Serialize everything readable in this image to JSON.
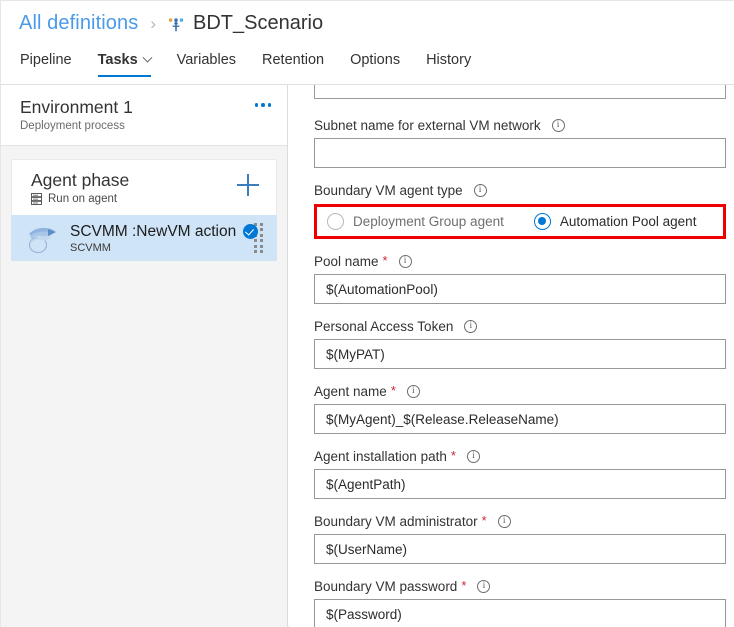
{
  "breadcrumb": {
    "root_label": "All definitions",
    "separator": "›",
    "current_label": "BDT_Scenario",
    "current_icon": "release-definition-icon"
  },
  "tabs": [
    {
      "label": "Pipeline",
      "active": false,
      "has_caret": false
    },
    {
      "label": "Tasks",
      "active": true,
      "has_caret": true
    },
    {
      "label": "Variables",
      "active": false,
      "has_caret": false
    },
    {
      "label": "Retention",
      "active": false,
      "has_caret": false
    },
    {
      "label": "Options",
      "active": false,
      "has_caret": false
    },
    {
      "label": "History",
      "active": false,
      "has_caret": false
    }
  ],
  "left_panel": {
    "environment": {
      "title": "Environment 1",
      "subtitle": "Deployment process",
      "more_icon": "ellipsis-icon"
    },
    "phase": {
      "title": "Agent phase",
      "subtitle": "Run on agent",
      "subtitle_icon": "server-icon",
      "add_icon": "plus-icon"
    },
    "task": {
      "title": "SCVMM :NewVM action",
      "subtitle": "SCVMM",
      "icon": "scvmm-icon",
      "status_icon": "check-circle-icon",
      "grip_icon": "drag-handle-icon",
      "selected": true
    }
  },
  "form": {
    "partial_field_top": {
      "value": "",
      "has_validation_squiggle": true
    },
    "fields": [
      {
        "id": "subnet-name",
        "label": "Subnet name for external VM network",
        "required": false,
        "info_icon": "info-icon",
        "value": "",
        "placeholder": ""
      },
      {
        "id": "pool-name",
        "label": "Pool name",
        "required": true,
        "info_icon": "info-icon",
        "value": "$(AutomationPool)",
        "placeholder": ""
      },
      {
        "id": "personal-access-token",
        "label": "Personal Access Token",
        "required": false,
        "info_icon": "info-icon",
        "value": "$(MyPAT)",
        "placeholder": ""
      },
      {
        "id": "agent-name",
        "label": "Agent name",
        "required": true,
        "info_icon": "info-icon",
        "value": "$(MyAgent)_$(Release.ReleaseName)",
        "placeholder": ""
      },
      {
        "id": "agent-installation-path",
        "label": "Agent installation path",
        "required": true,
        "info_icon": "info-icon",
        "value": "$(AgentPath)",
        "placeholder": ""
      },
      {
        "id": "boundary-vm-administrator",
        "label": "Boundary VM administrator",
        "required": true,
        "info_icon": "info-icon",
        "value": "$(UserName)",
        "placeholder": ""
      },
      {
        "id": "boundary-vm-password",
        "label": "Boundary VM password",
        "required": true,
        "info_icon": "info-icon",
        "value": "$(Password)",
        "placeholder": ""
      }
    ],
    "agent_type": {
      "label": "Boundary VM agent type",
      "info_icon": "info-icon",
      "options": [
        {
          "label": "Deployment Group agent",
          "selected": false
        },
        {
          "label": "Automation Pool agent",
          "selected": true
        }
      ],
      "highlight_color": "#ee0000"
    },
    "required_marker": "*"
  },
  "colors": {
    "accent": "#0078d4",
    "link": "#4a9ae8",
    "annotation": "#ee0000",
    "required": "#cc2936",
    "selected_row": "#cfe4f7",
    "panel_bg": "#f4f4f4"
  }
}
